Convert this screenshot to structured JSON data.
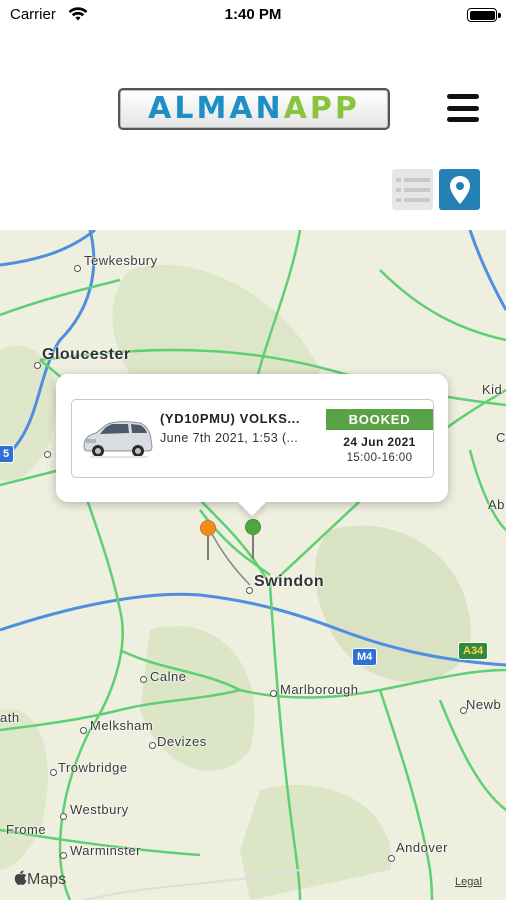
{
  "status_bar": {
    "carrier": "Carrier",
    "time": "1:40 PM"
  },
  "header": {
    "logo_part1": "ALMAN",
    "logo_part2": "APP",
    "menu_icon": "hamburger-menu-icon"
  },
  "view_toggle": {
    "list_icon": "list-view-icon",
    "map_icon": "map-pin-icon",
    "active": "map"
  },
  "map": {
    "places": {
      "tewkesbury": "Tewkesbury",
      "gloucester": "Gloucester",
      "swindon": "Swindon",
      "calne": "Calne",
      "marlborough": "Marlborough",
      "melksham": "Melksham",
      "devizes": "Devizes",
      "trowbridge": "Trowbridge",
      "westbury": "Westbury",
      "warminster": "Warminster",
      "andover": "Andover",
      "frome": "Frome",
      "bath_partial": "ath",
      "kid_partial": "Kid",
      "ab_partial": "Ab",
      "newb_partial": "Newb",
      "c_partial": "C"
    },
    "road_shields": {
      "m4": "M4",
      "a34": "A34",
      "left_partial": "5"
    },
    "attribution": "Maps",
    "legal": "Legal",
    "pins": [
      {
        "color": "#f08c1a"
      },
      {
        "color": "#4fa83d"
      }
    ]
  },
  "booking": {
    "title": "(YD10PMU) VOLKS...",
    "subtitle": "June 7th 2021, 1:53 (...",
    "status": "BOOKED",
    "date": "24 Jun 2021",
    "time": "15:00-16:00",
    "status_color": "#59a346"
  },
  "colors": {
    "brand_blue": "#1e8fc4",
    "brand_green": "#8ac43f",
    "toggle_active": "#2580b3"
  }
}
